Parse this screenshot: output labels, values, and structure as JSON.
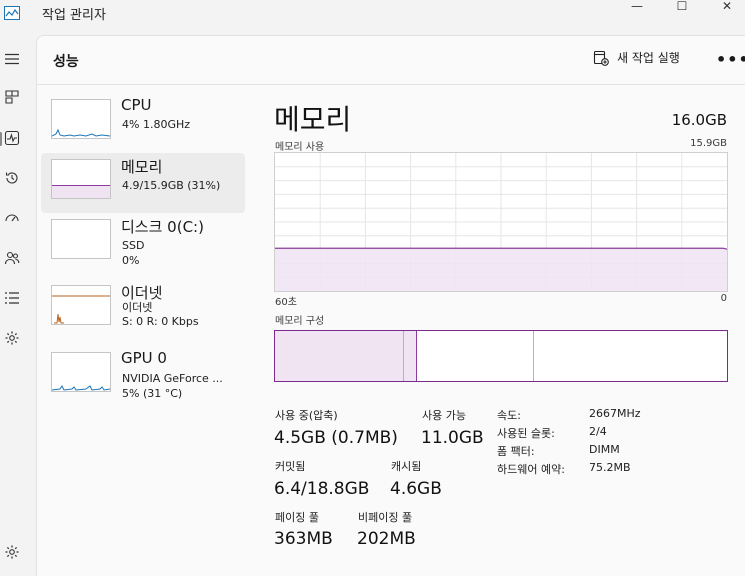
{
  "window": {
    "title": "작업 관리자",
    "minimize": "—",
    "maximize": "☐",
    "close": "✕"
  },
  "rail": {
    "items": [
      {
        "icon": "hamburger-menu-icon"
      },
      {
        "icon": "processes-icon"
      },
      {
        "icon": "performance-icon"
      },
      {
        "icon": "app-history-icon"
      },
      {
        "icon": "startup-apps-icon"
      },
      {
        "icon": "users-icon"
      },
      {
        "icon": "details-icon"
      },
      {
        "icon": "services-icon"
      },
      {
        "icon": "settings-icon"
      }
    ]
  },
  "header": {
    "title": "성능",
    "run_task": "새 작업 실행",
    "more": "•••"
  },
  "devices": [
    {
      "name": "CPU",
      "line1": "4% 1.80GHz",
      "line2": ""
    },
    {
      "name": "메모리",
      "line1": "4.9/15.9GB (31%)",
      "line2": ""
    },
    {
      "name": "디스크 0(C:)",
      "line1": "SSD",
      "line2": "0%"
    },
    {
      "name": "이더넷",
      "line1": "이더넷",
      "line2": "S: 0 R: 0 Kbps"
    },
    {
      "name": "GPU 0",
      "line1": "NVIDIA GeForce ...",
      "line2": "5% (31 °C)"
    }
  ],
  "detail": {
    "title": "메모리",
    "total": "16.0GB",
    "usage_label": "메모리 사용",
    "usage_max": "15.9GB",
    "time_left": "60초",
    "time_right": "0",
    "usage_level": 0.31,
    "composition_label": "메모리 구성",
    "stats": {
      "in_use_label": "사용 중(압축)",
      "in_use_value": "4.5GB (0.7MB)",
      "available_label": "사용 가능",
      "available_value": "11.0GB",
      "committed_label": "커밋됨",
      "committed_value": "6.4/18.8GB",
      "cached_label": "캐시됨",
      "cached_value": "4.6GB",
      "paged_label": "페이징 풀",
      "paged_value": "363MB",
      "nonpaged_label": "비페이징 풀",
      "nonpaged_value": "202MB"
    },
    "props": [
      {
        "key": "속도:",
        "value": "2667MHz"
      },
      {
        "key": "사용된 슬롯:",
        "value": "2/4"
      },
      {
        "key": "폼 팩터:",
        "value": "DIMM"
      },
      {
        "key": "하드웨어 예약:",
        "value": "75.2MB"
      }
    ]
  },
  "colors": {
    "memory": "#8b3c9c",
    "memory_fill": "#f0e4f3",
    "cpu": "#1c75b8",
    "ethernet": "#b8611a"
  }
}
